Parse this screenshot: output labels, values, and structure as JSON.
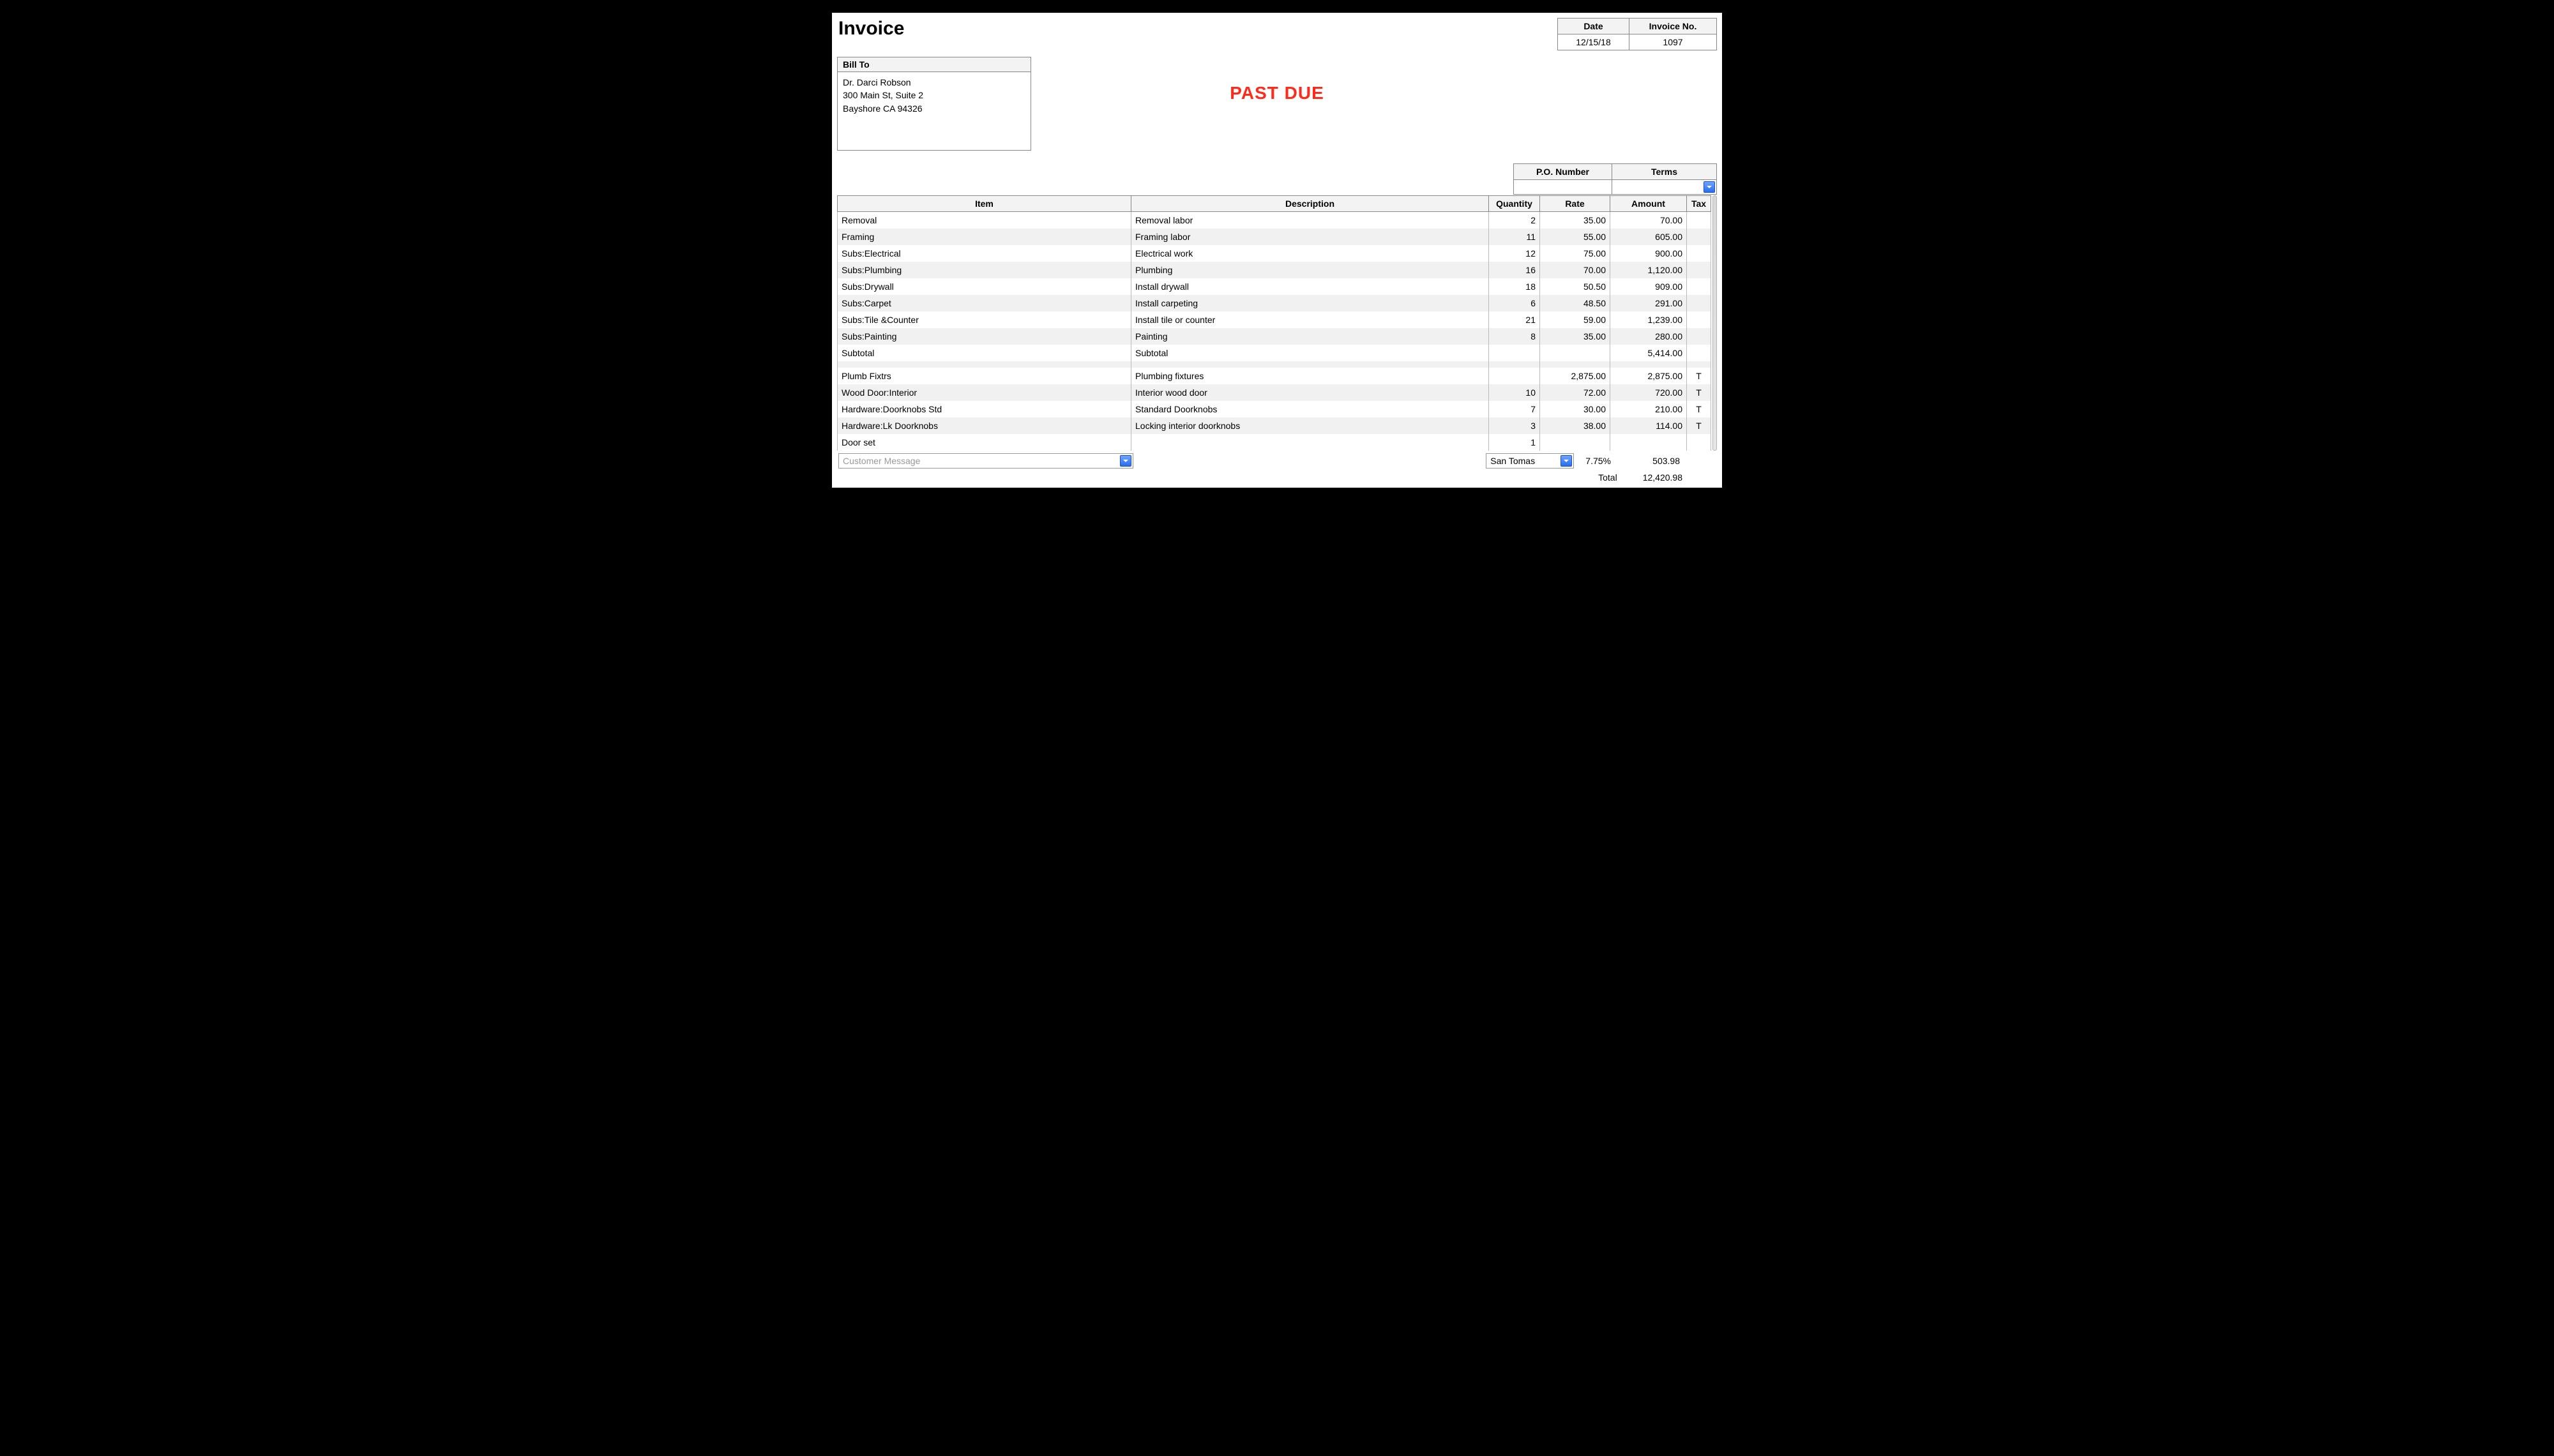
{
  "title": "Invoice",
  "date_info": {
    "date_label": "Date",
    "date": "12/15/18",
    "invno_label": "Invoice No.",
    "invno": "1097"
  },
  "bill_to": {
    "label": "Bill To",
    "body": "Dr. Darci Robson\n300 Main St, Suite 2\nBayshore CA 94326"
  },
  "stamp": "PAST DUE",
  "po_terms": {
    "po_label": "P.O. Number",
    "terms_label": "Terms",
    "po": "",
    "terms": ""
  },
  "grid": {
    "headers": {
      "item": "Item",
      "desc": "Description",
      "qty": "Quantity",
      "rate": "Rate",
      "amount": "Amount",
      "tax": "Tax"
    },
    "rows": [
      {
        "item": "Removal",
        "desc": "Removal labor",
        "qty": "2",
        "rate": "35.00",
        "amount": "70.00",
        "tax": ""
      },
      {
        "item": "Framing",
        "desc": "Framing labor",
        "qty": "11",
        "rate": "55.00",
        "amount": "605.00",
        "tax": ""
      },
      {
        "item": "Subs:Electrical",
        "desc": "Electrical work",
        "qty": "12",
        "rate": "75.00",
        "amount": "900.00",
        "tax": ""
      },
      {
        "item": "Subs:Plumbing",
        "desc": "Plumbing",
        "qty": "16",
        "rate": "70.00",
        "amount": "1,120.00",
        "tax": ""
      },
      {
        "item": "Subs:Drywall",
        "desc": "Install drywall",
        "qty": "18",
        "rate": "50.50",
        "amount": "909.00",
        "tax": ""
      },
      {
        "item": "Subs:Carpet",
        "desc": "Install carpeting",
        "qty": "6",
        "rate": "48.50",
        "amount": "291.00",
        "tax": ""
      },
      {
        "item": "Subs:Tile &Counter",
        "desc": "Install tile or counter",
        "qty": "21",
        "rate": "59.00",
        "amount": "1,239.00",
        "tax": ""
      },
      {
        "item": "Subs:Painting",
        "desc": "Painting",
        "qty": "8",
        "rate": "35.00",
        "amount": "280.00",
        "tax": ""
      },
      {
        "item": "Subtotal",
        "desc": "Subtotal",
        "qty": "",
        "rate": "",
        "amount": "5,414.00",
        "tax": ""
      },
      {
        "item": "",
        "desc": "",
        "qty": "",
        "rate": "",
        "amount": "",
        "tax": ""
      },
      {
        "item": "Plumb Fixtrs",
        "desc": "Plumbing fixtures",
        "qty": "",
        "rate": "2,875.00",
        "amount": "2,875.00",
        "tax": "T"
      },
      {
        "item": "Wood Door:Interior",
        "desc": "Interior wood door",
        "qty": "10",
        "rate": "72.00",
        "amount": "720.00",
        "tax": "T"
      },
      {
        "item": "Hardware:Doorknobs Std",
        "desc": "Standard Doorknobs",
        "qty": "7",
        "rate": "30.00",
        "amount": "210.00",
        "tax": "T"
      },
      {
        "item": "Hardware:Lk Doorknobs",
        "desc": "Locking interior doorknobs",
        "qty": "3",
        "rate": "38.00",
        "amount": "114.00",
        "tax": "T"
      },
      {
        "item": "Door set",
        "desc": "",
        "qty": "1",
        "rate": "",
        "amount": "",
        "tax": ""
      }
    ]
  },
  "footer": {
    "customer_message_placeholder": "Customer Message",
    "tax_location": "San Tomas",
    "tax_rate": "7.75%",
    "tax_amount": "503.98",
    "total_label": "Total",
    "total_amount": "12,420.98"
  }
}
